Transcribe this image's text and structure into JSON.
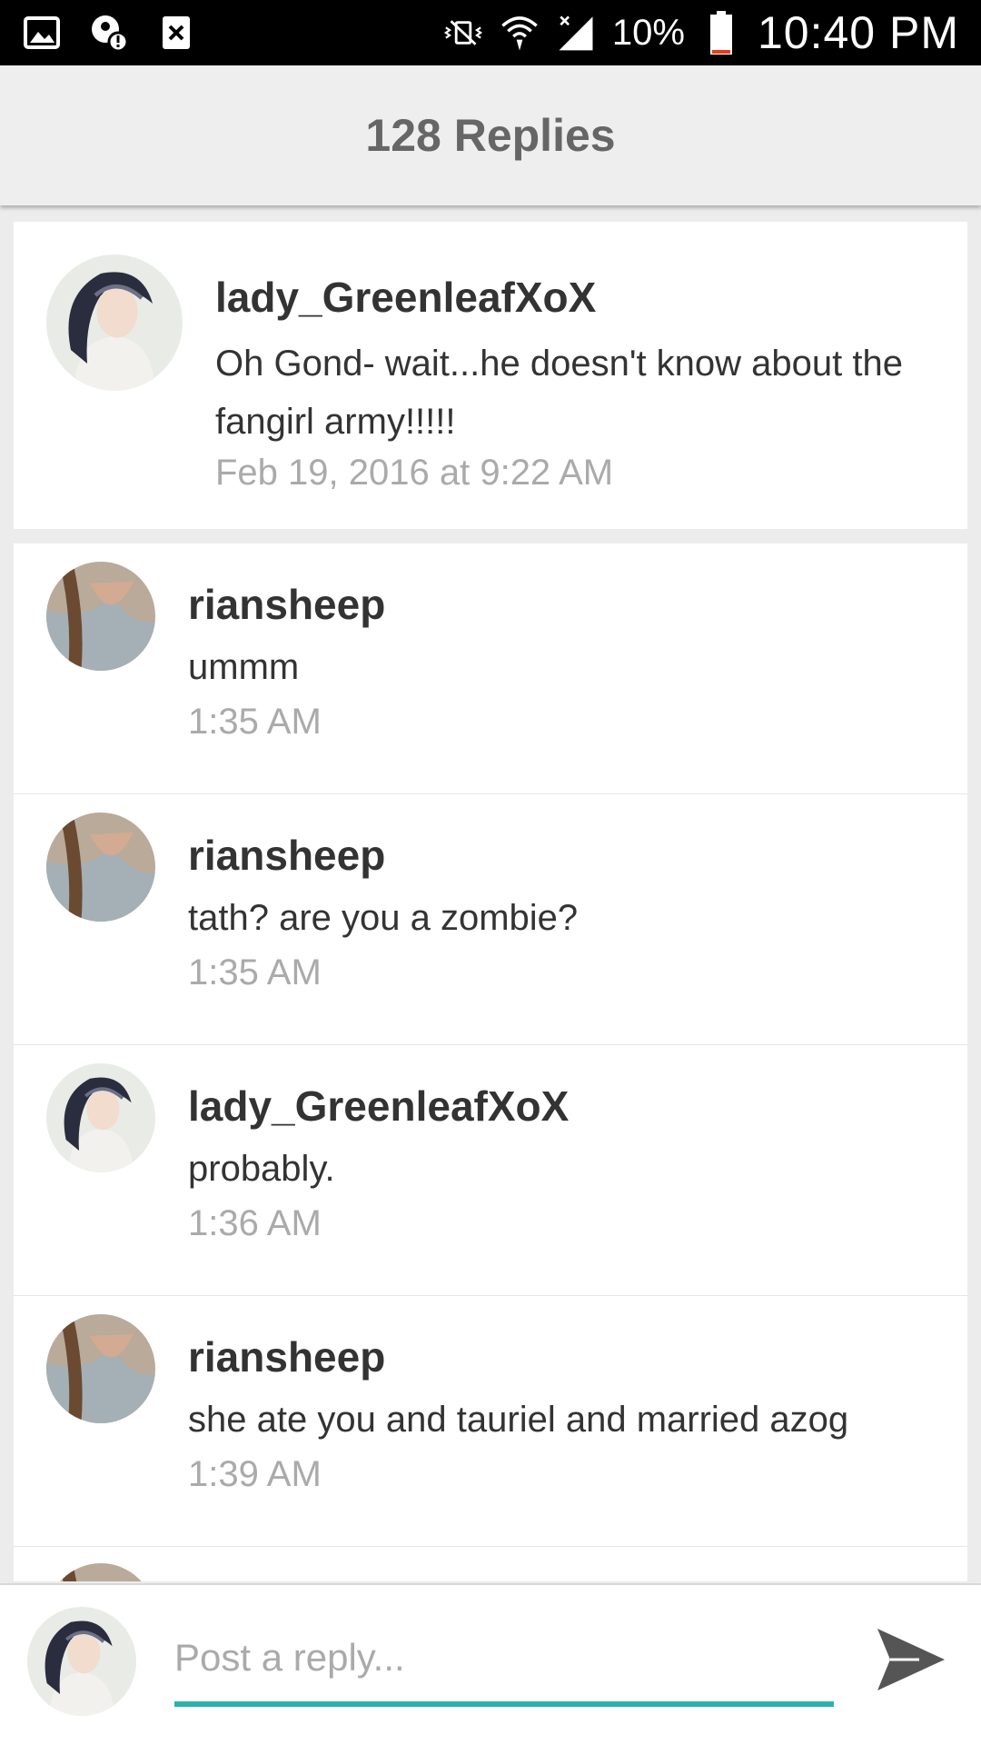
{
  "status_bar": {
    "left_icons": [
      "gallery-icon",
      "alert-person-icon",
      "close-box-icon"
    ],
    "right_icons": [
      "vibrate-off-icon",
      "wifi-icon",
      "signal-icon",
      "battery-icon"
    ],
    "battery_text": "10%",
    "battery_level": 0.1,
    "time": "10:40 PM"
  },
  "header": {
    "title": "128 Replies"
  },
  "original_comment": {
    "avatar": "avatar-lady-icon",
    "username": "lady_GreenleafXoX",
    "text": "Oh Gond- wait...he doesn't know about the fangirl army!!!!!",
    "time": "Feb 19, 2016 at 9:22 AM"
  },
  "replies": [
    {
      "avatar": "avatar-riansheep-icon",
      "username": "riansheep",
      "text": "ummm",
      "time": "1:35 AM"
    },
    {
      "avatar": "avatar-riansheep-icon",
      "username": "riansheep",
      "text": "tath? are you a zombie?",
      "time": "1:35 AM"
    },
    {
      "avatar": "avatar-lady-icon",
      "username": "lady_GreenleafXoX",
      "text": "probably.",
      "time": "1:36 AM"
    },
    {
      "avatar": "avatar-riansheep-icon",
      "username": "riansheep",
      "text": "she ate you and tauriel and married azog",
      "time": "1:39 AM"
    }
  ],
  "reply_bar": {
    "avatar": "avatar-lady-icon",
    "placeholder": "Post a reply...",
    "send_icon": "send-icon",
    "accent_color": "#2bb3aa"
  }
}
